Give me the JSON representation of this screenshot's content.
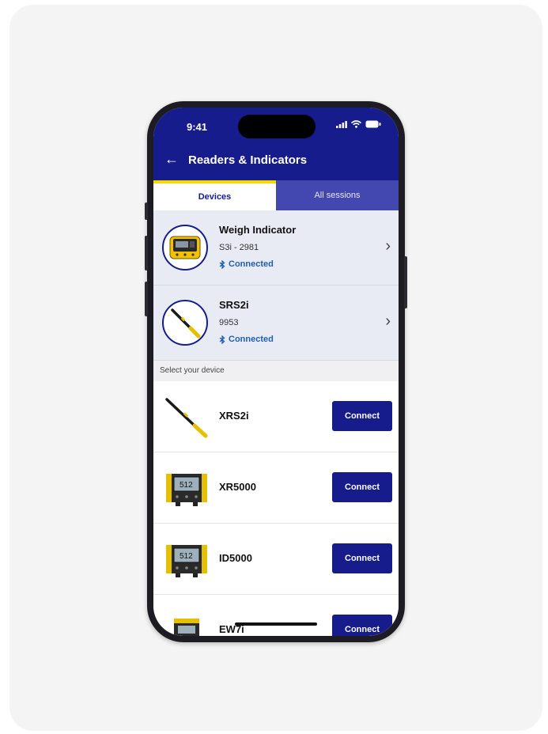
{
  "status": {
    "time": "9:41"
  },
  "header": {
    "title": "Readers & Indicators"
  },
  "tabs": [
    {
      "label": "Devices",
      "active": true
    },
    {
      "label": "All sessions",
      "active": false
    }
  ],
  "paired_devices": [
    {
      "name": "Weigh Indicator",
      "sub": "S3i - 2981",
      "status": "Connected",
      "icon": "weigh-indicator-icon"
    },
    {
      "name": "SRS2i",
      "sub": "9953",
      "status": "Connected",
      "icon": "wand-reader-icon"
    }
  ],
  "section_label": "Select your device",
  "available_devices": [
    {
      "name": "XRS2i",
      "button": "Connect",
      "icon": "wand-reader-icon"
    },
    {
      "name": "XR5000",
      "button": "Connect",
      "screen_text": "512",
      "icon": "indicator-icon"
    },
    {
      "name": "ID5000",
      "button": "Connect",
      "screen_text": "512",
      "icon": "indicator-icon"
    },
    {
      "name": "EW7i",
      "button": "Connect",
      "icon": "indicator-icon"
    }
  ],
  "colors": {
    "brand_navy": "#161c8c",
    "tab_inactive": "#4248b0",
    "accent_yellow": "#f5d800",
    "connected_blue": "#1f5fb0",
    "paired_bg": "#e9ebf4"
  }
}
